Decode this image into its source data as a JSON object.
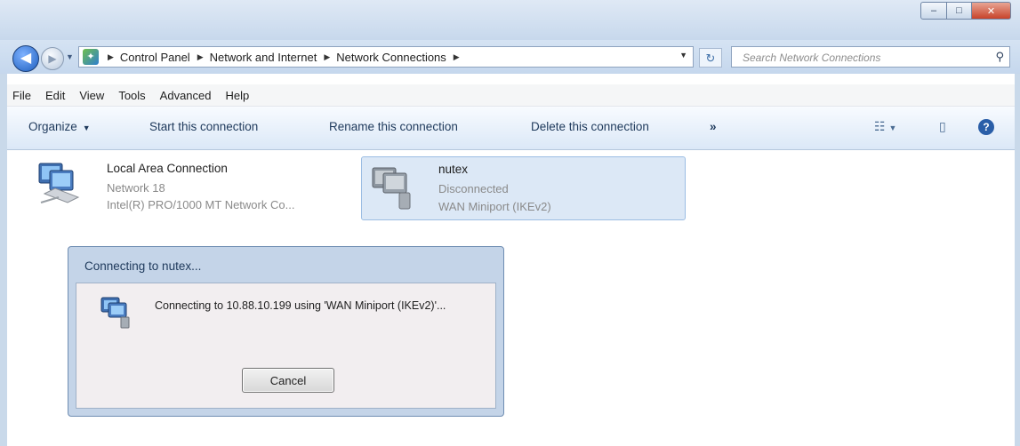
{
  "window": {
    "caption_buttons": {
      "minimize": "–",
      "maximize": "□",
      "close": "✕"
    }
  },
  "nav": {
    "back_glyph": "◀",
    "forward_glyph": "▶",
    "breadcrumbs": [
      "Control Panel",
      "Network and Internet",
      "Network Connections"
    ],
    "refresh_glyph": "↻",
    "search_placeholder": "Search Network Connections"
  },
  "menu": [
    "File",
    "Edit",
    "View",
    "Tools",
    "Advanced",
    "Help"
  ],
  "toolbar": {
    "organize": "Organize",
    "start": "Start this connection",
    "rename": "Rename this connection",
    "delete": "Delete this connection",
    "more": "»"
  },
  "connections": [
    {
      "name": "Local Area Connection",
      "status": "Network  18",
      "device": "Intel(R) PRO/1000 MT Network Co..."
    },
    {
      "name": "nutex",
      "status": "Disconnected",
      "device": "WAN Miniport (IKEv2)"
    }
  ],
  "dialog": {
    "title": "Connecting to nutex...",
    "message": "Connecting to 10.88.10.199 using 'WAN Miniport (IKEv2)'...",
    "cancel": "Cancel"
  },
  "colors": {
    "frame": "#c9d9ea",
    "selected_bg": "#dce8f6",
    "dialog_frame": "#c4d4e8"
  }
}
